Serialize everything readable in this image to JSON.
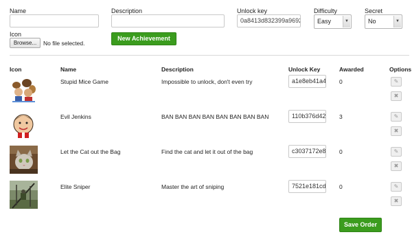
{
  "form": {
    "name_label": "Name",
    "description_label": "Description",
    "unlock_key_label": "Unlock key",
    "unlock_key_value": "0a8413d832399a9692",
    "difficulty_label": "Difficulty",
    "difficulty_value": "Easy",
    "secret_label": "Secret",
    "secret_value": "No",
    "icon_label": "Icon",
    "browse_label": "Browse...",
    "file_status": "No file selected.",
    "submit_label": "New Achievement"
  },
  "table": {
    "headers": {
      "icon": "Icon",
      "name": "Name",
      "description": "Description",
      "unlock_key": "Unlock Key",
      "awarded": "Awarded",
      "options": "Options"
    },
    "rows": [
      {
        "name": "Stupid Mice Game",
        "description": "Impossible to unlock, don't even try",
        "key": "a1e8eb41a4",
        "awarded": "0",
        "icon": "mice-icon"
      },
      {
        "name": "Evil Jenkins",
        "description": "BAN BAN BAN BAN BAN BAN BAN BAN",
        "key": "110b376d42",
        "awarded": "3",
        "icon": "jenkins-icon"
      },
      {
        "name": "Let the Cat out the Bag",
        "description": "Find the cat and let it out of the bag",
        "key": "c3037172e8",
        "awarded": "0",
        "icon": "cat-icon"
      },
      {
        "name": "Elite Sniper",
        "description": "Master the art of sniping",
        "key": "7521e181cd",
        "awarded": "0",
        "icon": "sniper-icon"
      }
    ]
  },
  "save_label": "Save Order",
  "colors": {
    "accent": "#3b9c1e",
    "border": "#c8c8c8"
  }
}
